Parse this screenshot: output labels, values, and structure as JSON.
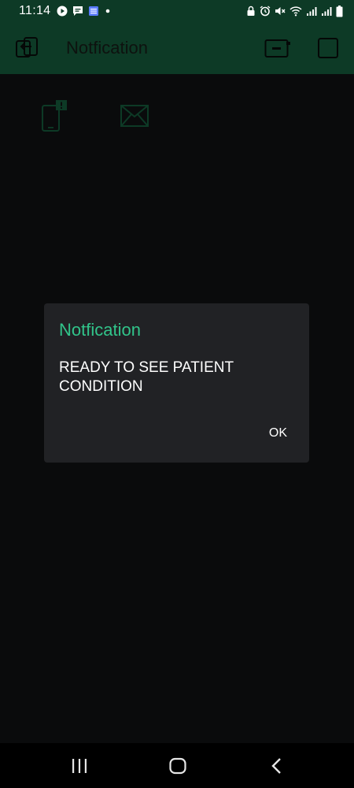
{
  "status_bar": {
    "time": "11:14",
    "left_icons": [
      "play-circle-icon",
      "chat-icon",
      "calendar-icon",
      "dot-icon"
    ],
    "right_icons": [
      "lock-icon",
      "alarm-icon",
      "mute-icon",
      "wifi-icon",
      "signal-icon",
      "signal-icon",
      "battery-icon"
    ]
  },
  "app_bar": {
    "title": "Notfication",
    "icons": [
      "exit-icon",
      "device-icon",
      "square-icon"
    ]
  },
  "widgets": [
    {
      "icon": "phone-notification-icon",
      "badge": "!"
    },
    {
      "icon": "email-icon"
    }
  ],
  "dialog": {
    "title": "Notfication",
    "message": "READY TO SEE PATIENT CONDITION",
    "ok_label": "OK"
  },
  "nav_bar": {
    "icons": [
      "recent-apps-icon",
      "home-icon",
      "back-icon"
    ]
  },
  "colors": {
    "app_bar": "#0d3a26",
    "accent": "#31c48a",
    "dialog_bg": "#212225",
    "content_bg": "#0a0b0c"
  }
}
